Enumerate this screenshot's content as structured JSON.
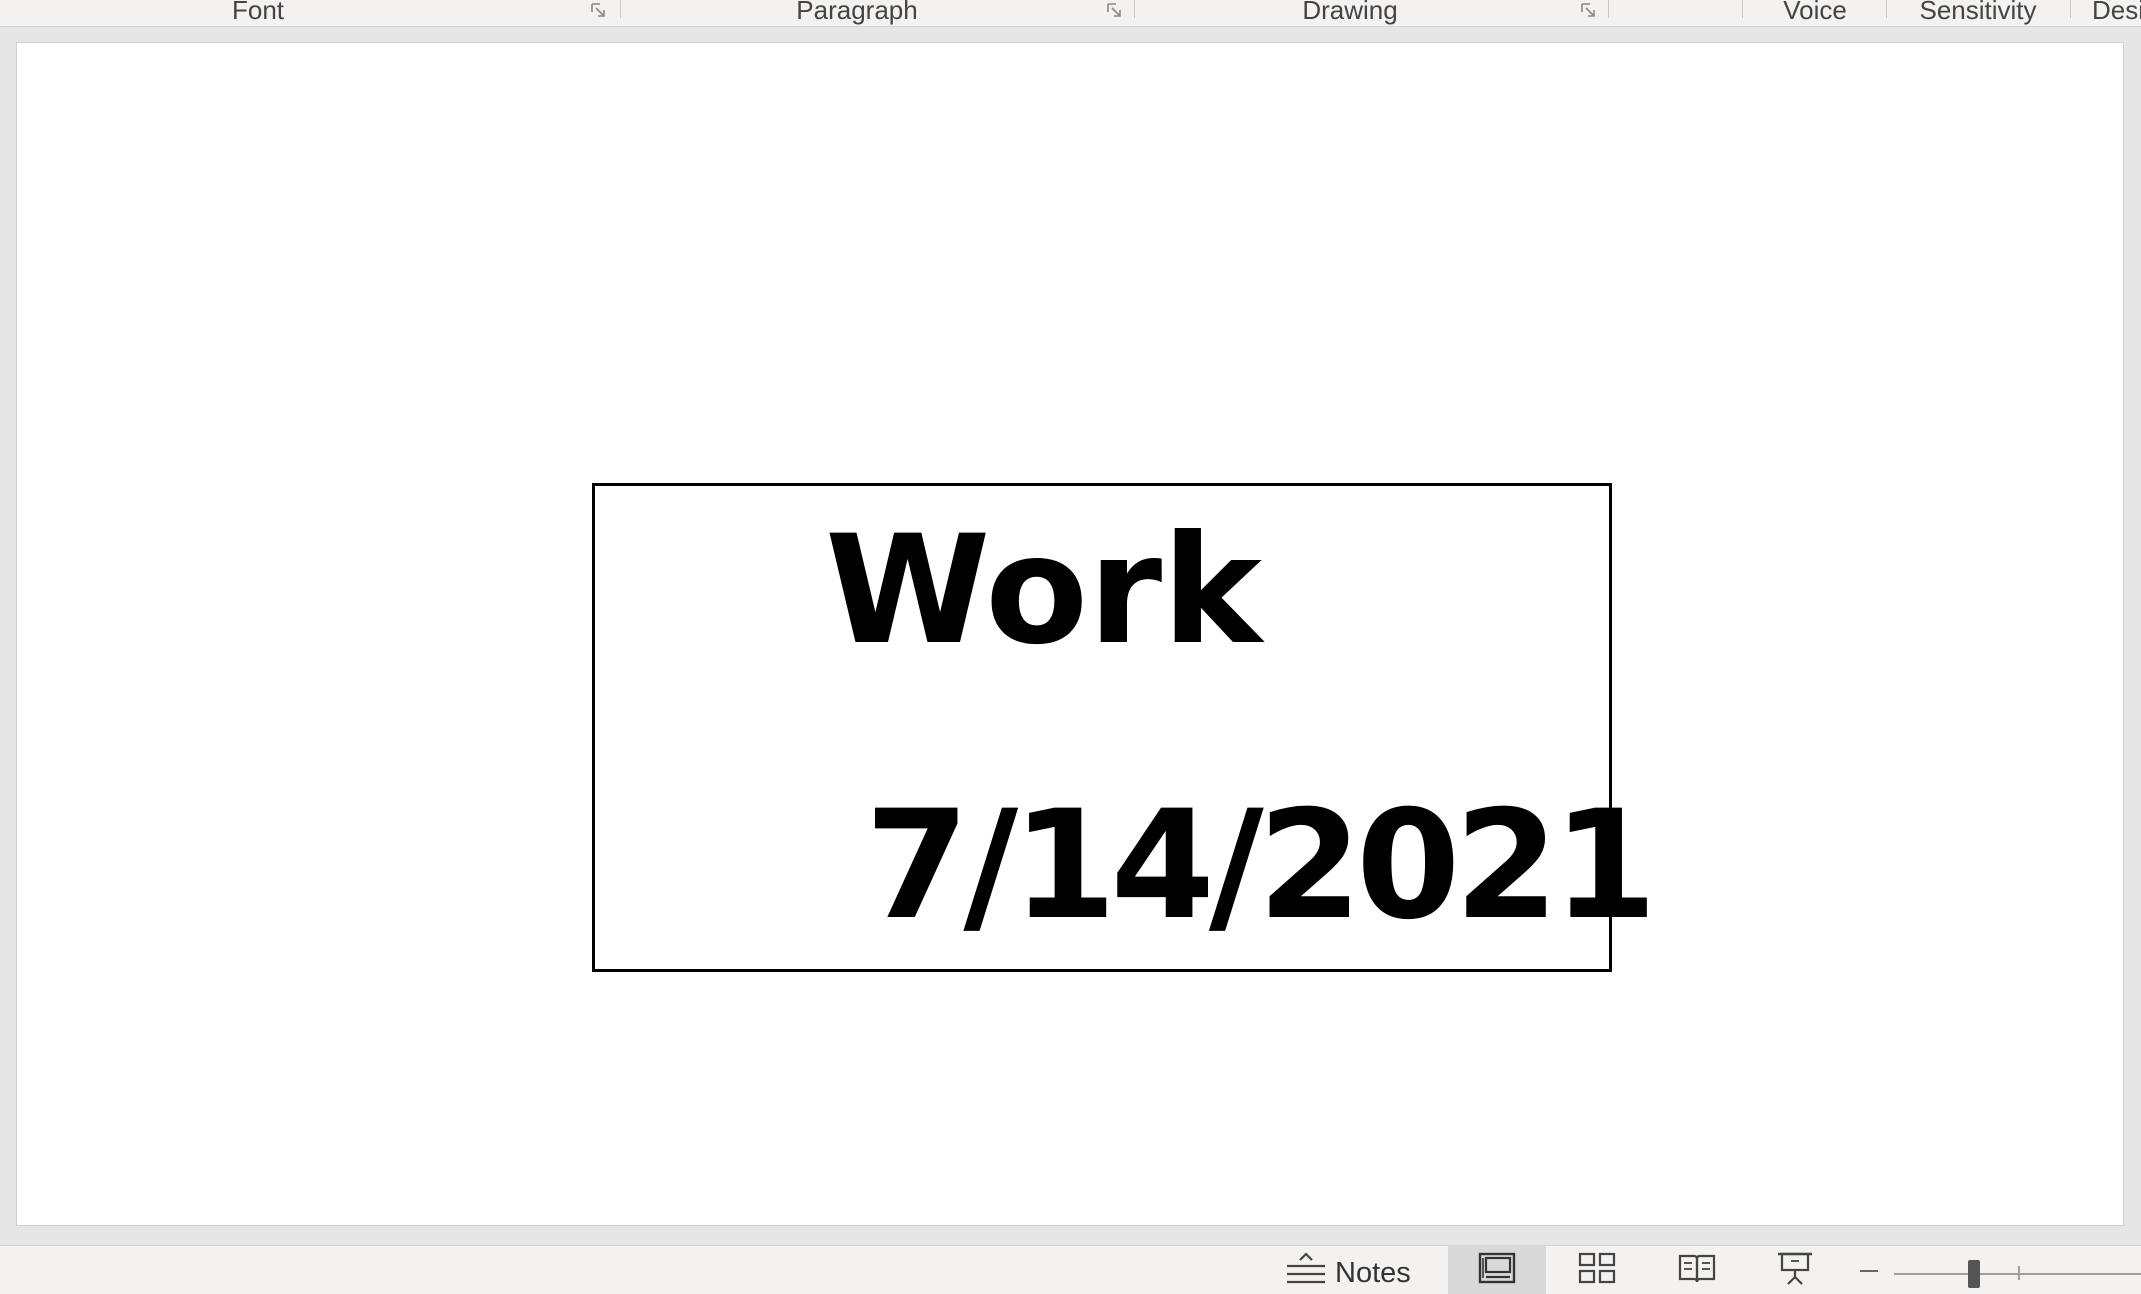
{
  "ribbon": {
    "groups": [
      {
        "label": "Font",
        "has_launcher": true
      },
      {
        "label": "Paragraph",
        "has_launcher": true
      },
      {
        "label": "Drawing",
        "has_launcher": true
      },
      {
        "label": "Voice",
        "has_launcher": false
      },
      {
        "label": "Sensitivity",
        "has_launcher": false
      },
      {
        "label": "Desi",
        "has_launcher": false
      }
    ]
  },
  "slide": {
    "title": "Work",
    "date": "7/14/2021"
  },
  "statusbar": {
    "notes_label": "Notes",
    "views": [
      {
        "name": "normal-view",
        "icon": "normal-view-icon",
        "active": true
      },
      {
        "name": "slide-sorter-view",
        "icon": "slide-sorter-icon",
        "active": false
      },
      {
        "name": "reading-view",
        "icon": "reading-view-icon",
        "active": false
      },
      {
        "name": "slide-show-view",
        "icon": "slide-show-icon",
        "active": false
      }
    ],
    "zoom_icon_minus": "zoom-out-icon"
  },
  "colors": {
    "ribbon_bg": "#f3f2f1",
    "canvas_bg": "#e6e6e6",
    "slide_bg": "#ffffff",
    "text": "#000000"
  }
}
